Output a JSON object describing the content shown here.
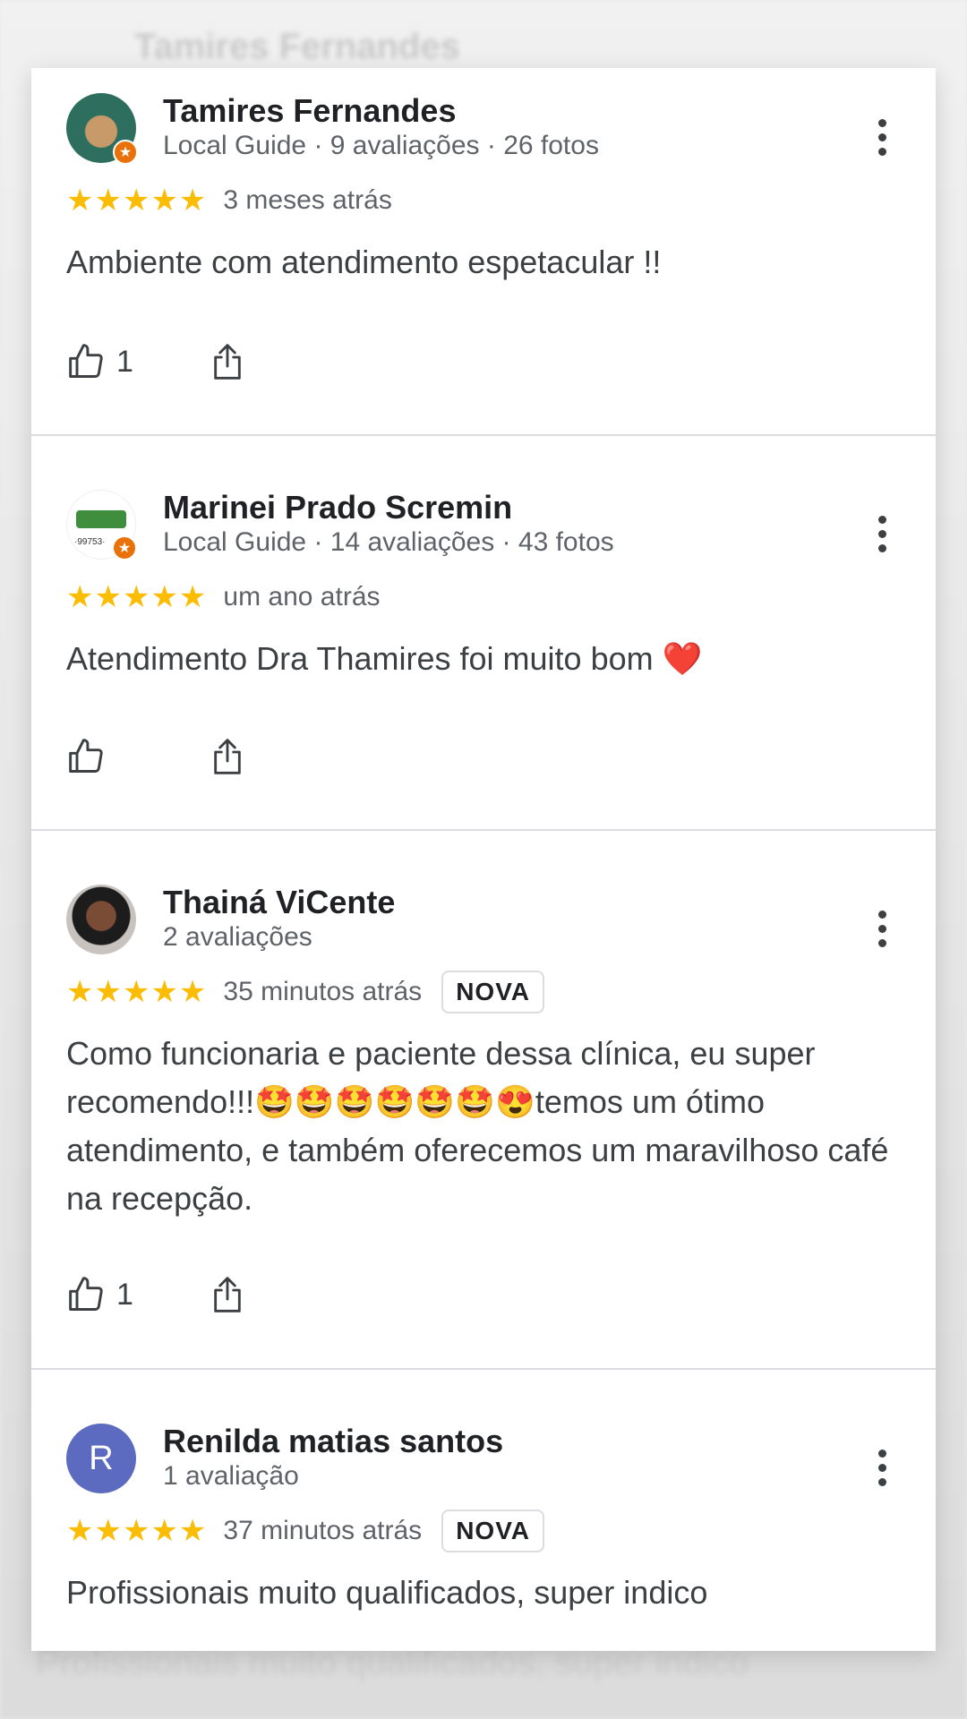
{
  "background": {
    "ghost_top": "Tamires Fernandes",
    "ghost_bottom": "Profissionais muito qualificados, super indico"
  },
  "reviews": [
    {
      "name": "Tamires Fernandes",
      "meta": "Local Guide · 9 avaliações · 26 fotos",
      "avatar_initial": "",
      "local_guide_badge": true,
      "stars": "★★★★★",
      "time": "3 meses atrás",
      "new_label": "",
      "text": "Ambiente com atendimento espetacular !!",
      "likes": "1"
    },
    {
      "name": "Marinei Prado Scremin",
      "meta": "Local Guide · 14 avaliações · 43 fotos",
      "avatar_initial": "",
      "avatar_text": "·99753·",
      "local_guide_badge": true,
      "stars": "★★★★★",
      "time": "um ano atrás",
      "new_label": "",
      "text": "Atendimento Dra Thamires foi muito bom ❤️",
      "likes": ""
    },
    {
      "name": "Thainá ViCente",
      "meta": "2 avaliações",
      "avatar_initial": "",
      "local_guide_badge": false,
      "stars": "★★★★★",
      "time": "35 minutos atrás",
      "new_label": "NOVA",
      "text": "Como funcionaria e paciente dessa clínica, eu super recomendo!!!🤩🤩🤩🤩🤩🤩😍temos um ótimo atendimento, e também oferecemos um maravilhoso café na recepção.",
      "likes": "1"
    },
    {
      "name": "Renilda matias santos",
      "meta": "1 avaliação",
      "avatar_initial": "R",
      "local_guide_badge": false,
      "stars": "★★★★★",
      "time": "37 minutos atrás",
      "new_label": "NOVA",
      "text": "Profissionais muito qualificados, super indico",
      "likes": ""
    }
  ],
  "colors": {
    "star": "#fbbc04",
    "local_guide_badge": "#e8710a",
    "avatar_r": "#5c6bc0"
  },
  "icons": [
    "thumbs-up-icon",
    "share-icon",
    "more-vert-icon",
    "star-icon",
    "local-guide-icon"
  ]
}
